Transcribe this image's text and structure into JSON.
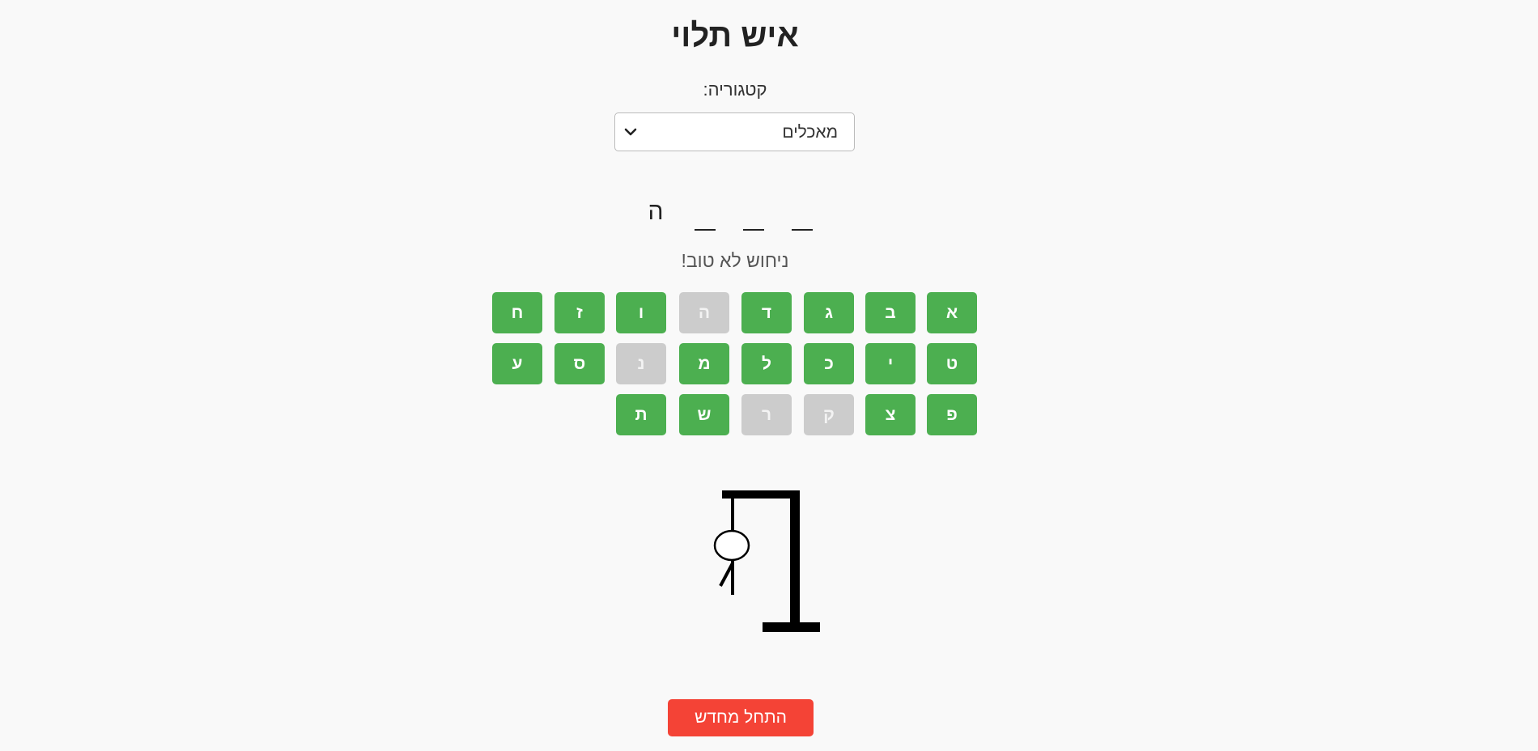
{
  "header": {
    "title": "איש תלוי"
  },
  "category": {
    "label": "קטגוריה:",
    "selected": "מאכלים"
  },
  "word": {
    "slots": [
      "_",
      "_",
      "_",
      "ה"
    ]
  },
  "message": "ניחוש לא טוב!",
  "keyboard": {
    "row1": [
      "א",
      "ב",
      "ג",
      "ד",
      "ה",
      "ו",
      "ז",
      "ח"
    ],
    "row2": [
      "ט",
      "י",
      "כ",
      "ל",
      "מ",
      "נ",
      "ס",
      "ע"
    ],
    "row3": [
      "פ",
      "צ",
      "ק",
      "ר",
      "ש",
      "ת"
    ],
    "used": [
      "ה",
      "נ",
      "ק",
      "ר"
    ]
  },
  "hangman": {
    "wrong_guesses": 3,
    "parts_shown": [
      "head",
      "body",
      "left-arm"
    ]
  },
  "colors": {
    "key_available": "#4caf50",
    "key_used": "#cccccc",
    "restart": "#f44336",
    "background": "#f9f9f9"
  },
  "restart_label": "התחל מחדש"
}
